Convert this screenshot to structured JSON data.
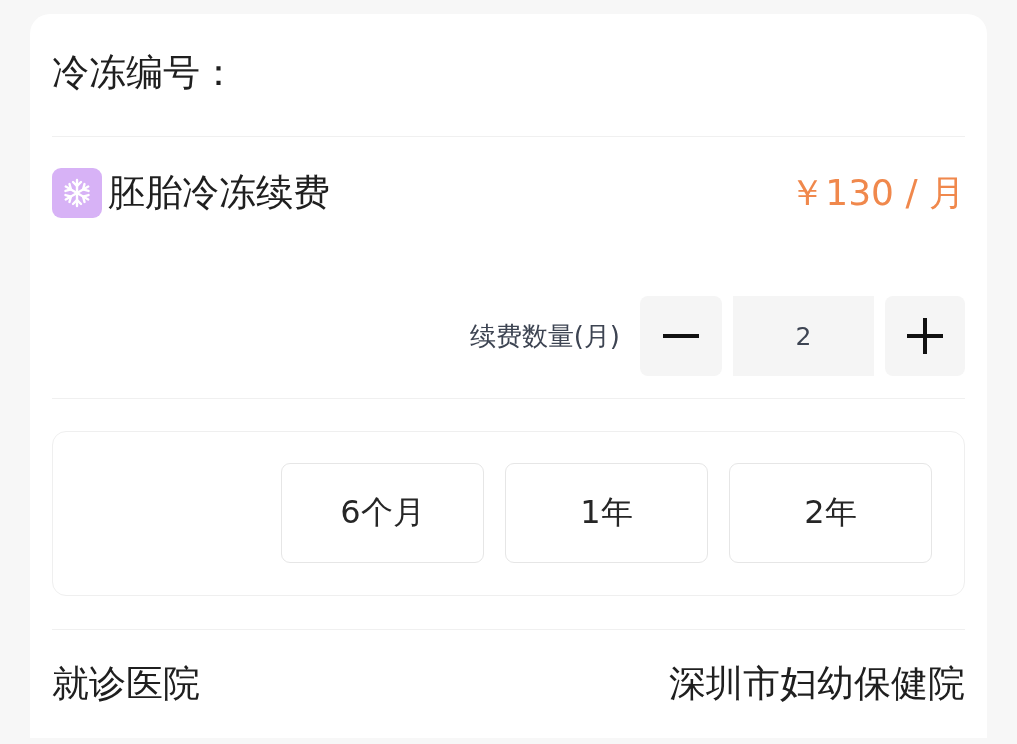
{
  "freeze_number": {
    "label": "冷冻编号："
  },
  "product": {
    "title": "胚胎冷冻续费",
    "price": "￥130 / 月"
  },
  "quantity": {
    "label": "续费数量(月)",
    "value": "2"
  },
  "renewal_options": [
    {
      "label": "6个月",
      "selected": false
    },
    {
      "label": "1年",
      "selected": false
    },
    {
      "label": "2年",
      "selected": false
    }
  ],
  "hospital": {
    "label": "就诊医院",
    "value": "深圳市妇幼保健院"
  }
}
